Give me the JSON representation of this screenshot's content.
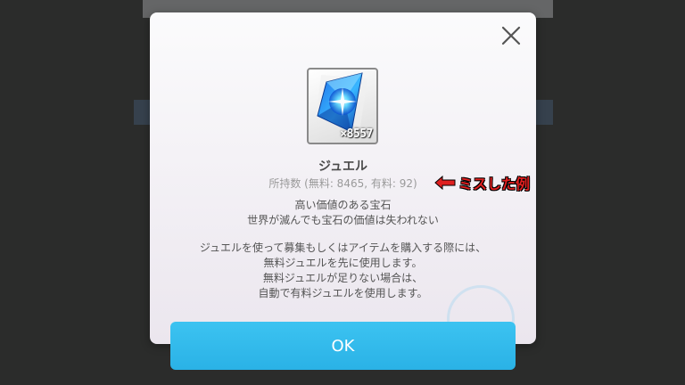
{
  "dialog": {
    "item_name": "ジュエル",
    "owned_text": "所持数 (無料: 8465, 有料: 92)",
    "quantity_label": "×8557",
    "flavor_lines": [
      "高い価値のある宝石",
      "世界が滅んでも宝石の価値は失われない"
    ],
    "info_lines": [
      "ジュエルを使って募集もしくはアイテムを購入する際には、",
      "無料ジュエルを先に使用します。",
      "無料ジュエルが足りない場合は、",
      "自動で有料ジュエルを使用します。"
    ],
    "ok_label": "OK",
    "close_icon": "close-icon"
  },
  "annotation": {
    "text": "ミスした例",
    "arrow_icon": "left-arrow-icon",
    "color": "#e02020"
  },
  "colors": {
    "accent": "#2ab2e6",
    "backdrop": "#2b2c2b"
  }
}
